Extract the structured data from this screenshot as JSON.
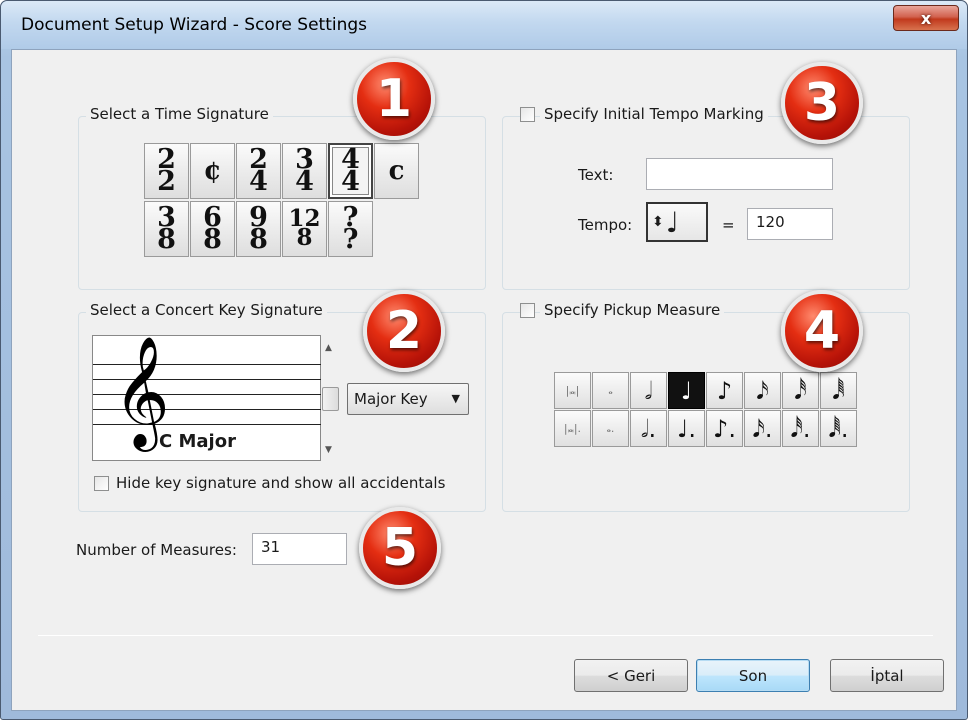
{
  "window": {
    "title": "Document Setup Wizard - Score Settings",
    "close_glyph": "x"
  },
  "time_signature": {
    "title": "Select a Time Signature",
    "row1": [
      {
        "top": "2",
        "bottom": "2"
      },
      {
        "single": "¢"
      },
      {
        "top": "2",
        "bottom": "4"
      },
      {
        "top": "3",
        "bottom": "4"
      },
      {
        "top": "4",
        "bottom": "4",
        "selected": true
      },
      {
        "single": "c"
      }
    ],
    "row2": [
      {
        "top": "3",
        "bottom": "8"
      },
      {
        "top": "6",
        "bottom": "8"
      },
      {
        "top": "9",
        "bottom": "8"
      },
      {
        "top": "12",
        "bottom": "8"
      },
      {
        "top": "?",
        "bottom": "?"
      }
    ]
  },
  "key_signature": {
    "title": "Select a Concert Key Signature",
    "key_name": "C Major",
    "clef_glyph": "𝄞",
    "mode_select": "Major Key",
    "hide_checkbox_label": "Hide key signature and show all accidentals",
    "hide_checked": false
  },
  "tempo": {
    "checkbox_label": "Specify Initial Tempo Marking",
    "checked": false,
    "text_label": "Text:",
    "text_value": "",
    "tempo_label": "Tempo:",
    "equals": "=",
    "tempo_value": "120",
    "note_glyph": "♩"
  },
  "pickup": {
    "checkbox_label": "Specify Pickup Measure",
    "checked": false,
    "row1": [
      "|𝅜|",
      "𝅝",
      "𝅗𝅥",
      "♩",
      "♪",
      "𝅘𝅥𝅯",
      "𝅘𝅥𝅰",
      "𝅘𝅥𝅱"
    ],
    "row2": [
      "|𝅜|.",
      "𝅝.",
      "𝅗𝅥.",
      "♩.",
      "♪.",
      "𝅘𝅥𝅯.",
      "𝅘𝅥𝅰.",
      "𝅘𝅥𝅱."
    ],
    "selected_index": 3
  },
  "measures": {
    "label": "Number of Measures:",
    "value": "31"
  },
  "badges": [
    "1",
    "2",
    "3",
    "4",
    "5"
  ],
  "buttons": {
    "back": "< Geri",
    "finish": "Son",
    "cancel": "İptal"
  },
  "colors": {
    "badge": "#d42a10",
    "window_frame": "#a8c4e2",
    "client_bg": "#f0f0f0"
  }
}
